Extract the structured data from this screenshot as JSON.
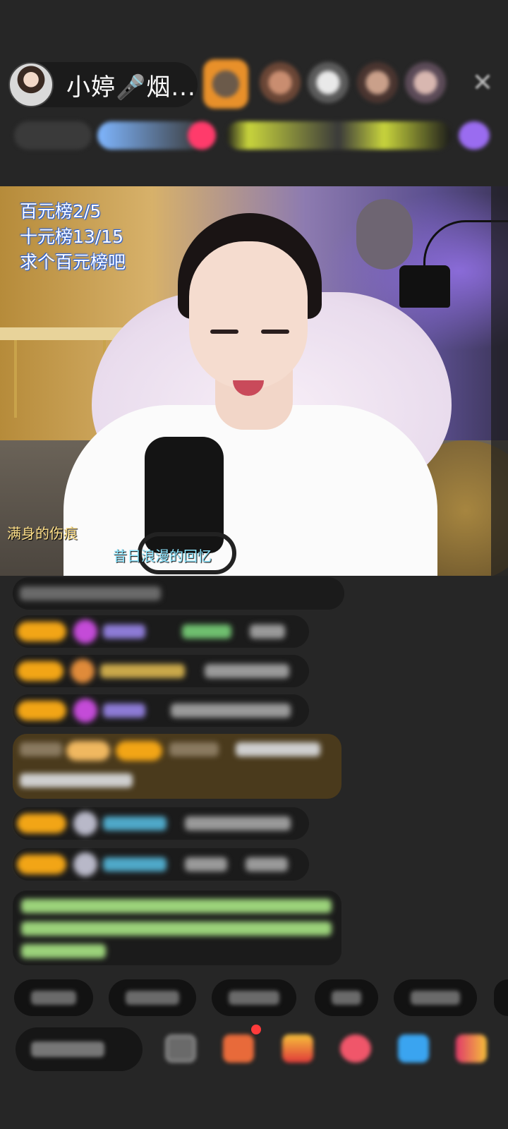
{
  "host": {
    "name": "小婷🎤烟..."
  },
  "video": {
    "overlay_lines": [
      "百元榜2/5",
      "十元榜13/15",
      "求个百元榜吧"
    ],
    "lyric_left": "满身的伤痕",
    "lyric_center": "昔日浪漫的回忆"
  },
  "colors": {
    "background": "#262626",
    "badge": "#f2a516",
    "highlight_row": "#4a3a1c"
  },
  "icons": {
    "close": "close-icon",
    "gift": "gift-icon",
    "share": "share-icon",
    "emoji": "emoji-icon"
  }
}
